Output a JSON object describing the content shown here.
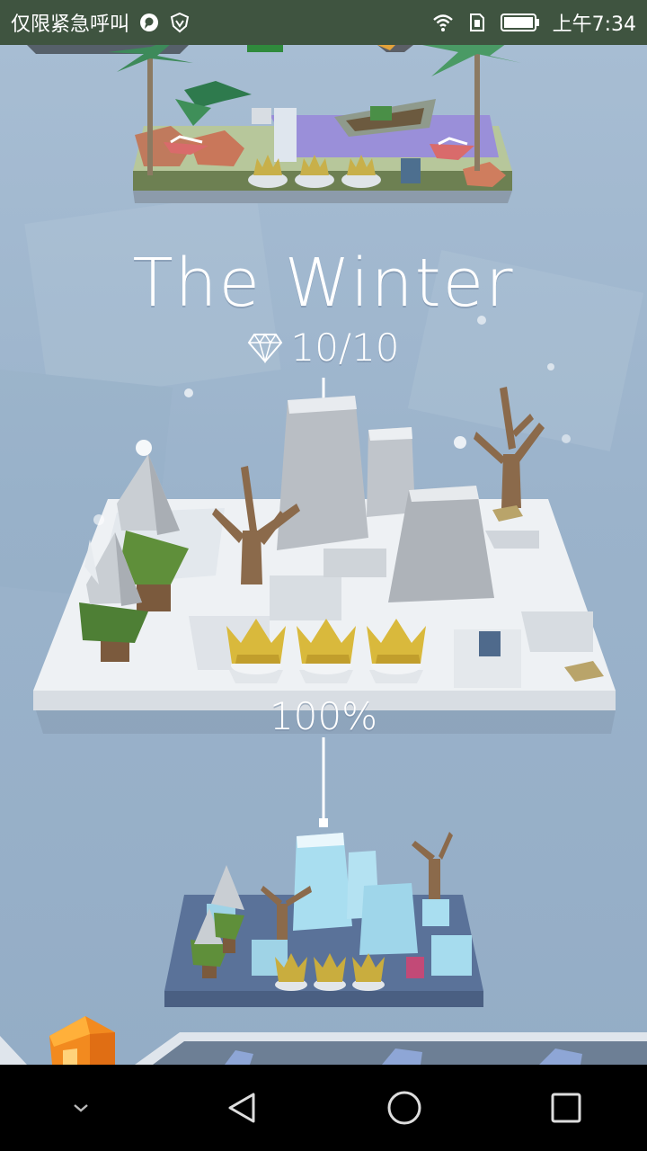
{
  "status_bar": {
    "carrier": "仅限紧急呼叫",
    "time": "上午7:34"
  },
  "level": {
    "title": "The Winter",
    "gems": "10/10",
    "progress": "100%"
  },
  "colors": {
    "status_bg": "#3f5440",
    "sky": "#9fb6cc",
    "snow": "#eef1f4",
    "crown": "#d9b93c",
    "ice": "#a9def0",
    "frozen_base": "#5a7299"
  },
  "icons": {
    "status": [
      "chat-bubble-icon",
      "shield-icon",
      "wifi-icon",
      "sim-icon",
      "battery-icon"
    ],
    "nav": [
      "collapse-icon",
      "back-icon",
      "home-icon",
      "recents-icon"
    ]
  }
}
